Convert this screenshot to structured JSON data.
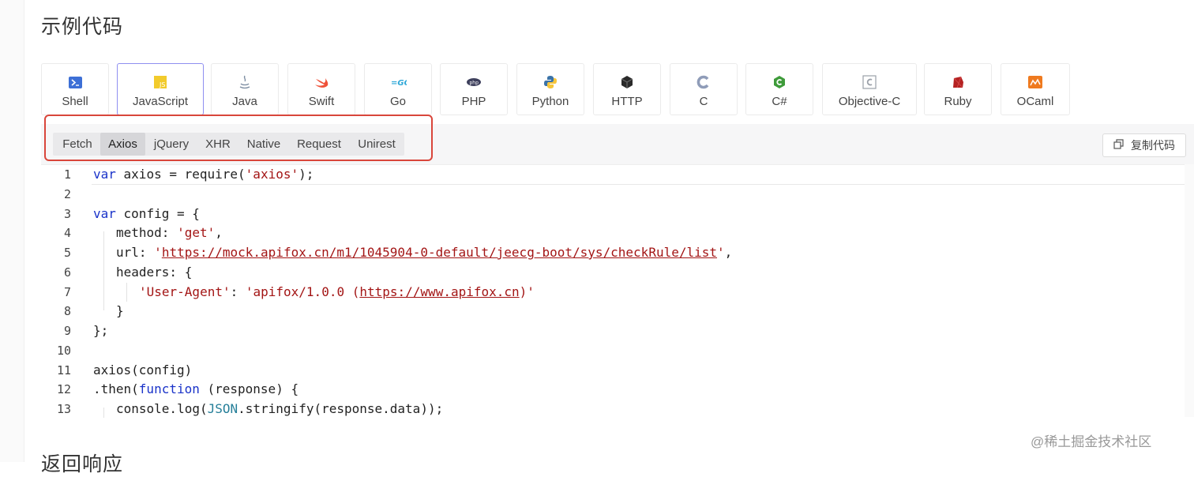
{
  "section_title": "示例代码",
  "next_section_title": "返回响应",
  "languages": [
    {
      "label": "Shell",
      "icon": "shell-icon"
    },
    {
      "label": "JavaScript",
      "icon": "js-icon",
      "active": true
    },
    {
      "label": "Java",
      "icon": "java-icon"
    },
    {
      "label": "Swift",
      "icon": "swift-icon"
    },
    {
      "label": "Go",
      "icon": "go-icon"
    },
    {
      "label": "PHP",
      "icon": "php-icon"
    },
    {
      "label": "Python",
      "icon": "python-icon"
    },
    {
      "label": "HTTP",
      "icon": "http-icon"
    },
    {
      "label": "C",
      "icon": "c-icon"
    },
    {
      "label": "C#",
      "icon": "csharp-icon"
    },
    {
      "label": "Objective-C",
      "icon": "objc-icon"
    },
    {
      "label": "Ruby",
      "icon": "ruby-icon"
    },
    {
      "label": "OCaml",
      "icon": "ocaml-icon"
    }
  ],
  "libraries": [
    "Fetch",
    "Axios",
    "jQuery",
    "XHR",
    "Native",
    "Request",
    "Unirest"
  ],
  "active_library": "Axios",
  "copy_button": "复制代码",
  "code": {
    "line_numbers": [
      "1",
      "2",
      "3",
      "4",
      "5",
      "6",
      "7",
      "8",
      "9",
      "10",
      "11",
      "12",
      "13"
    ],
    "l1_kw": "var",
    "l1_rest": " axios = require(",
    "l1_str": "'axios'",
    "l1_end": ");",
    "l3_kw": "var",
    "l3_rest": " config = {",
    "l4_key": "method: ",
    "l4_str": "'get'",
    "l4_end": ",",
    "l5_key": "url: ",
    "l5_q1": "'",
    "l5_url": "https://mock.apifox.cn/m1/1045904-0-default/jeecg-boot/sys/checkRule/list",
    "l5_q2": "'",
    "l5_end": ",",
    "l6": "headers: {",
    "l7_key": "'User-Agent'",
    "l7_colon": ": ",
    "l7_str1": "'apifox/1.0.0 (",
    "l7_url": "https://www.apifox.cn",
    "l7_str2": ")'",
    "l8": "}",
    "l9": "};",
    "l11": "axios(config)",
    "l12_a": ".then(",
    "l12_kw": "function",
    "l12_b": " (response) {",
    "l13_a": "console.log(",
    "l13_json": "JSON",
    "l13_b": ".stringify(response.data));"
  },
  "watermark": "@稀土掘金技术社区",
  "colors": {
    "keyword": "#1a33c9",
    "string": "#a31515",
    "highlight_border": "#d9463b",
    "active_tab_border": "#8f8ff0"
  }
}
